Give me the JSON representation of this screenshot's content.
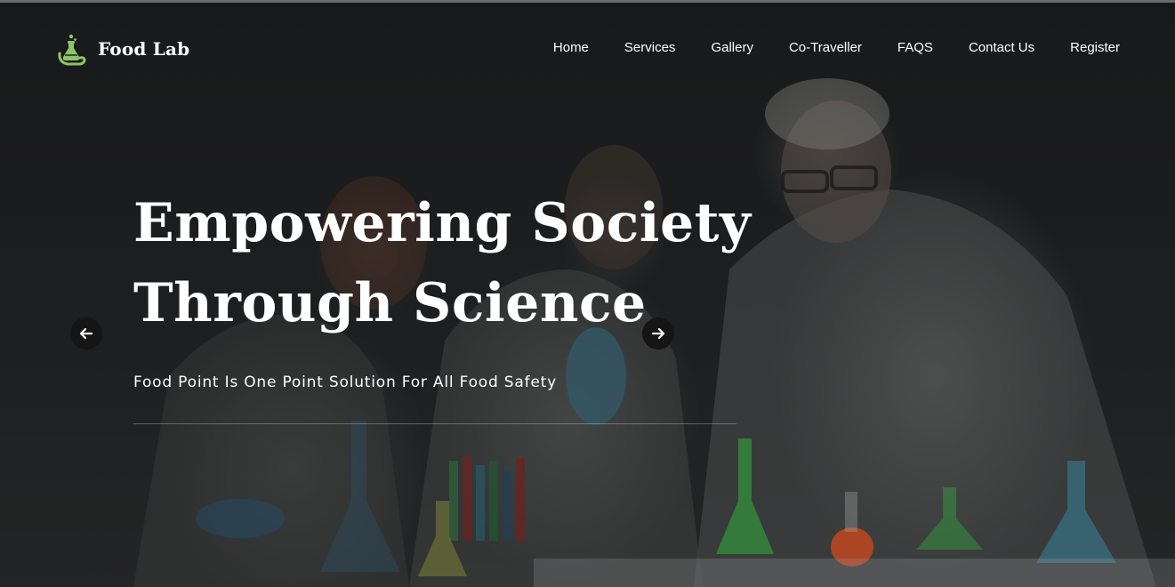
{
  "brand": {
    "name": "Food Lab",
    "icon": "lab-flask-hand-icon",
    "accent_color": "#8cc46a"
  },
  "nav": {
    "items": [
      {
        "label": "Home"
      },
      {
        "label": "Services"
      },
      {
        "label": "Gallery"
      },
      {
        "label": "Co-Traveller"
      },
      {
        "label": "FAQS"
      },
      {
        "label": "Contact Us"
      },
      {
        "label": "Register"
      }
    ]
  },
  "hero": {
    "headline_line1": "Empowering Society",
    "headline_line2": "Through Science",
    "subheading": "Food Point Is One Point Solution For All Food Safety",
    "prev_icon": "arrow-left-icon",
    "next_icon": "arrow-right-icon"
  }
}
